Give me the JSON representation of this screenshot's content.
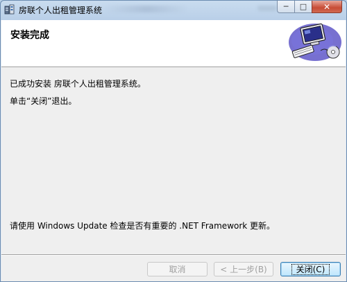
{
  "window": {
    "title": "房联个人出租管理系统",
    "controls": {
      "minimize_glyph": "─",
      "maximize_glyph": "□",
      "close_glyph": "✕"
    }
  },
  "header": {
    "title": "安装完成",
    "icon": "computer-setup-icon"
  },
  "content": {
    "line1": "已成功安装 房联个人出租管理系统。",
    "line2": "单击“关闭”退出。",
    "line3": "请使用 Windows Update 检查是否有重要的 .NET Framework 更新。"
  },
  "footer": {
    "cancel_label": "取消",
    "back_label": "< 上一步(B)",
    "close_label": "关闭(C)"
  },
  "colors": {
    "accent_border": "#3c7fb1",
    "title_bar": "#b9cfe8",
    "close_button": "#c74c36"
  }
}
